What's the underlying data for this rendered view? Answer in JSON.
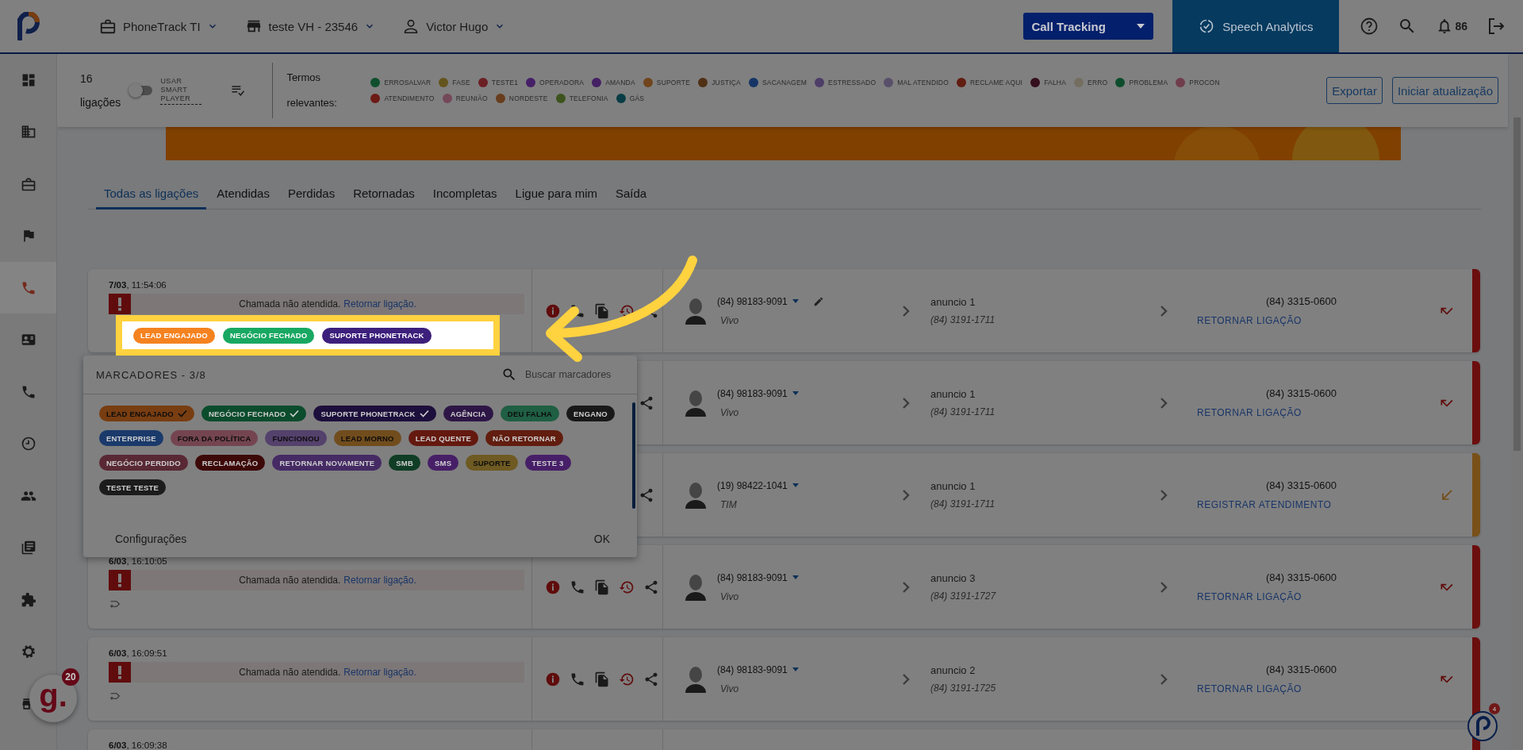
{
  "header": {
    "account": "PhoneTrack TI",
    "store": "teste VH - 23546",
    "user": "Victor Hugo",
    "product": "Call Tracking",
    "speech_analytics": "Speech Analytics",
    "notifications": "86"
  },
  "sidebar": {
    "items": [
      {
        "selected": false
      },
      {
        "selected": false
      },
      {
        "selected": false
      },
      {
        "selected": false
      },
      {
        "selected": true
      },
      {
        "selected": false
      },
      {
        "selected": false
      },
      {
        "selected": false
      },
      {
        "selected": false
      },
      {
        "selected": false
      },
      {
        "selected": false
      },
      {
        "selected": false
      },
      {
        "selected": false
      }
    ]
  },
  "toolbar": {
    "count": "16",
    "count_label": "ligações",
    "smart_player": {
      "label": "USAR SMART PLAYER",
      "on": false
    },
    "terms_label": "Termos relevantes:",
    "terms": [
      {
        "label": "ERROSALVAR",
        "color": "#0f4f2d"
      },
      {
        "label": "FASE",
        "color": "#64541d"
      },
      {
        "label": "TESTE1",
        "color": "#6b2025"
      },
      {
        "label": "OPERADORA",
        "color": "#451f67"
      },
      {
        "label": "AMANDA",
        "color": "#442064"
      },
      {
        "label": "SUPORTE",
        "color": "#70451d"
      },
      {
        "label": "JUSTIÇA",
        "color": "#503015"
      },
      {
        "label": "SACANAGEM",
        "color": "#153566"
      },
      {
        "label": "ESTRESSADO",
        "color": "#4d3d68"
      },
      {
        "label": "MAL ATENDIDO",
        "color": "#594f6a"
      },
      {
        "label": "RECLAME AQUI",
        "color": "#621d11"
      },
      {
        "label": "FALHA",
        "color": "#350f1d"
      },
      {
        "label": "ERRO",
        "color": "#736e60"
      },
      {
        "label": "PROBLEMA",
        "color": "#0d4d2d"
      },
      {
        "label": "PROCON",
        "color": "#703d4c"
      },
      {
        "label": "ATENDIMENTO",
        "color": "#6c1b15"
      },
      {
        "label": "REUNIÃO",
        "color": "#734858"
      },
      {
        "label": "NORDESTE",
        "color": "#683d1d"
      },
      {
        "label": "TELEFONIA",
        "color": "#3d541d"
      },
      {
        "label": "GÁS",
        "color": "#093d45"
      }
    ],
    "buttons": [
      "Exportar",
      "Iniciar atualização"
    ]
  },
  "tabs": [
    {
      "label": "Todas as ligações",
      "selected": true
    },
    {
      "label": "Atendidas",
      "selected": false
    },
    {
      "label": "Perdidas",
      "selected": false
    },
    {
      "label": "Retornadas",
      "selected": false
    },
    {
      "label": "Incompletas",
      "selected": false
    },
    {
      "label": "Ligue para mim",
      "selected": false
    },
    {
      "label": "Saída",
      "selected": false
    }
  ],
  "calls": [
    {
      "datetime": "**7/03**, 11:54:06",
      "status": "Chamada não atendida.",
      "status_link": "Retornar ligação.",
      "obscured": false,
      "contact": "(84) 98183-9091",
      "carrier": "Vivo",
      "editable": true,
      "campaign": "anuncio 1",
      "campaign_number": "(84) 3191-1711",
      "destination": "(84) 3315-0600",
      "action": "RETORNAR LIGAÇÃO",
      "kind": "missed",
      "color": "#6b0e0e"
    },
    {
      "obscured": true,
      "contact": "(84) 98183-9091",
      "carrier": "Vivo",
      "editable": false,
      "campaign": "anuncio 1",
      "campaign_number": "(84) 3191-1711",
      "destination": "(84) 3315-0600",
      "action": "RETORNAR LIGAÇÃO",
      "kind": "missed",
      "color": "#6b0e0e"
    },
    {
      "obscured": true,
      "contact": "(19) 98422-1041",
      "carrier": "TIM",
      "editable": false,
      "campaign": "anuncio 1",
      "campaign_number": "(84) 3191-1711",
      "destination": "(84) 3315-0600",
      "action": "REGISTRAR ATENDIMENTO",
      "kind": "incoming",
      "color": "#785018"
    },
    {
      "datetime": "**6/03**, 16:10:05",
      "status": "Chamada não atendida.",
      "status_link": "Retornar ligação.",
      "obscured": false,
      "contact": "(84) 98183-9091",
      "carrier": "Vivo",
      "editable": false,
      "campaign": "anuncio 3",
      "campaign_number": "(84) 3191-1727",
      "destination": "(84) 3315-0600",
      "action": "RETORNAR LIGAÇÃO",
      "kind": "missed",
      "color": "#6b0e0e"
    },
    {
      "datetime": "**6/03**, 16:09:51",
      "status": "Chamada não atendida.",
      "status_link": "Retornar ligação.",
      "obscured": false,
      "contact": "(84) 98183-9091",
      "carrier": "Vivo",
      "editable": false,
      "campaign": "anuncio 2",
      "campaign_number": "(84) 3191-1725",
      "destination": "(84) 3315-0600",
      "action": "RETORNAR LIGAÇÃO",
      "kind": "missed",
      "color": "#6b0e0e"
    },
    {
      "datetime": "**6/03**, 16:09:38",
      "obscured": false,
      "color": "#6b0e0e"
    }
  ],
  "markers_popup": {
    "title": "MARCADORES - 3/8",
    "search": {
      "placeholder": "Buscar marcadores"
    },
    "markers": [
      {
        "label": "LEAD ENGAJADO",
        "color": "#783d11",
        "selected": true
      },
      {
        "label": "NEGÓCIO FECHADO",
        "color": "#0b4c2d",
        "selected": true
      },
      {
        "label": "SUPORTE PHONETRACK",
        "color": "#1d0f3c",
        "selected": true
      },
      {
        "label": "AGÊNCIA",
        "color": "#2d1646",
        "selected": false
      },
      {
        "label": "DEU FALHA",
        "color": "#1f5f43",
        "selected": false
      },
      {
        "label": "ENGANO",
        "color": "#191919",
        "selected": false
      },
      {
        "label": "ENTERPRISE",
        "color": "#1a3a6b",
        "selected": false
      },
      {
        "label": "FORA DA POLÍTICA",
        "color": "#744551",
        "selected": false
      },
      {
        "label": "FUNCIONOU",
        "color": "#54416c",
        "selected": false
      },
      {
        "label": "LEAD MORNO",
        "color": "#714d1d",
        "selected": false
      },
      {
        "label": "LEAD QUENTE",
        "color": "#64190f",
        "selected": false
      },
      {
        "label": "NÃO RETORNAR",
        "color": "#621d0f",
        "selected": false
      },
      {
        "label": "NEGÓCIO PERDIDO",
        "color": "#592835",
        "selected": false
      },
      {
        "label": "RECLAMAÇÃO",
        "color": "#3d0808",
        "selected": false
      },
      {
        "label": "RETORNAR NOVAMENTE",
        "color": "#452a64",
        "selected": false
      },
      {
        "label": "SMB",
        "color": "#0f3d25",
        "selected": false
      },
      {
        "label": "SMS",
        "color": "#471f67",
        "selected": false
      },
      {
        "label": "SUPORTE",
        "color": "#6e5a22",
        "selected": false
      },
      {
        "label": "TESTE 3",
        "color": "#471f68",
        "selected": false
      },
      {
        "label": "TESTE TESTE",
        "color": "#1c1c1c",
        "selected": false
      }
    ],
    "footer": [
      "Configurações",
      "OK"
    ]
  },
  "tutorial_highlight": {
    "tags": [
      {
        "label": "LEAD ENGAJADO",
        "color": "#f58220"
      },
      {
        "label": "NEGÓCIO FECHADO",
        "color": "#18a862"
      },
      {
        "label": "SUPORTE PHONETRACK",
        "color": "#3d1f7c"
      }
    ]
  },
  "chat_widget": {
    "logo": "g.",
    "count": "20"
  },
  "help_widget": {
    "count": "4"
  }
}
